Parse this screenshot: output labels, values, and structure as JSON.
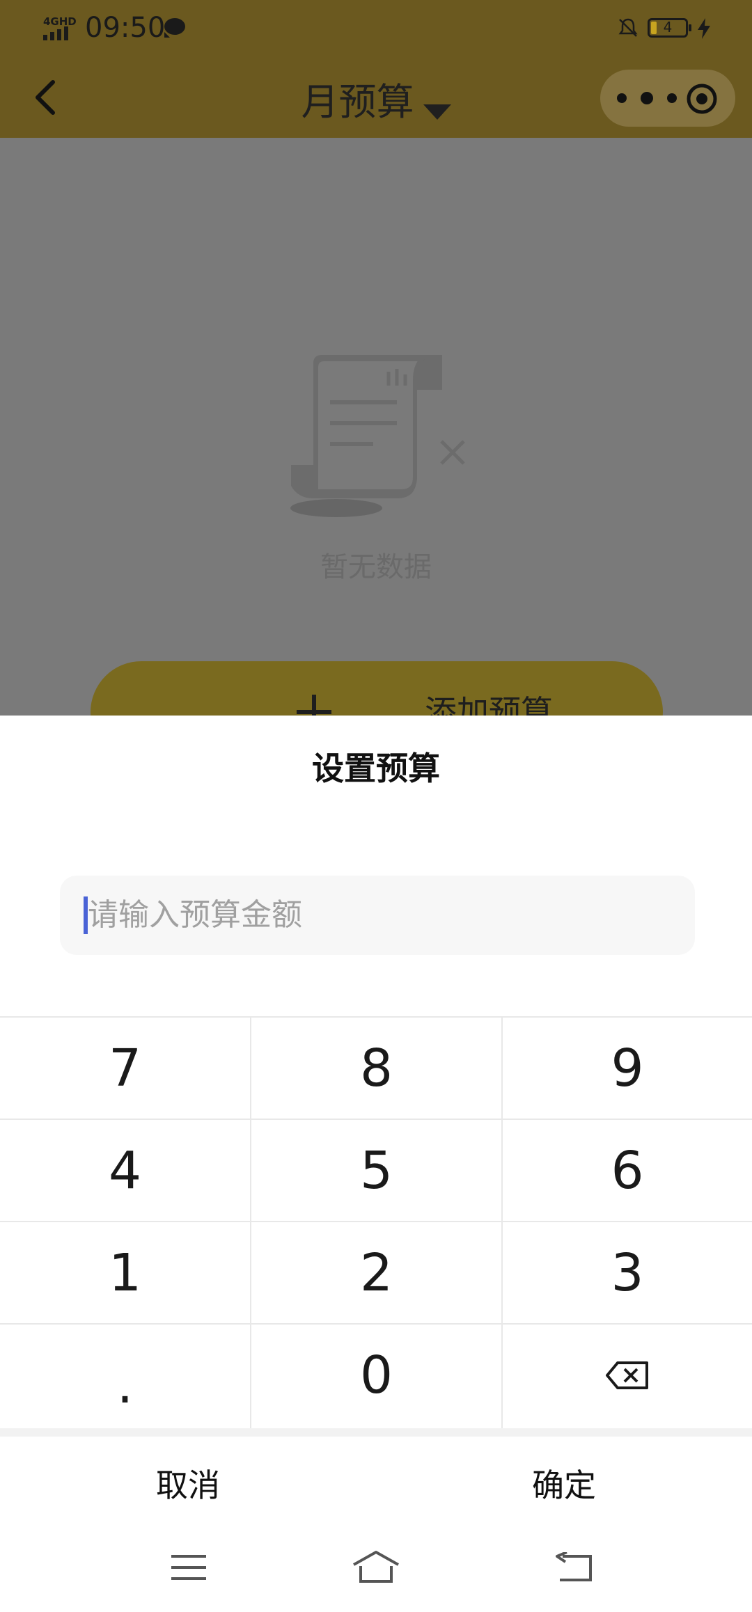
{
  "status_bar": {
    "network": "4GHD",
    "time": "09:50",
    "battery": "4"
  },
  "header": {
    "title": "月预算"
  },
  "content": {
    "empty_text": "暂无数据",
    "add_button_label": "添加预算"
  },
  "sheet": {
    "title": "设置预算",
    "amount_placeholder": "请输入预算金额",
    "keys": [
      "7",
      "8",
      "9",
      "4",
      "5",
      "6",
      "1",
      "2",
      "3",
      ".",
      "0"
    ],
    "cancel_label": "取消",
    "confirm_label": "确定"
  },
  "colors": {
    "header_dimmed": "#6b591f",
    "overlay_gray": "#7a7a7a",
    "button_dimmed": "#7a6a1f",
    "cursor_blue": "#4a63d6"
  },
  "icons": [
    "back-icon",
    "caret-down-icon",
    "more-icon",
    "target-icon",
    "receipt-empty-icon",
    "plus-icon",
    "backspace-icon",
    "menu-icon",
    "home-icon",
    "back-nav-icon"
  ]
}
